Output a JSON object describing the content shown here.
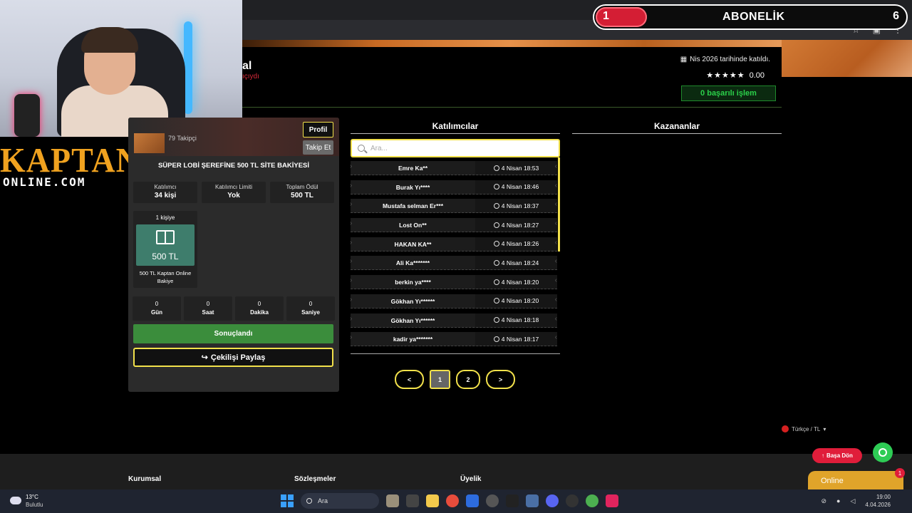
{
  "browser": {
    "window_controls": [
      "─",
      "▢",
      "✕"
    ],
    "toolbar_icons": [
      "☆",
      "▣",
      "⋮"
    ]
  },
  "subscriber_bar": {
    "left_count": "1",
    "title": "ABONELİK",
    "right_count": "6"
  },
  "logo": {
    "line1": "KAPTAN",
    "line2": "ONLINE.COM"
  },
  "profile": {
    "name": "al",
    "subtitle": "ıçıydı",
    "joined": "Nis 2026 tarihinde katıldı.",
    "stars": "★★★★★",
    "rating": "0.00",
    "success_label": "0 başarılı işlem"
  },
  "giveaway": {
    "followers": "79 Takipçi",
    "profile_btn": "Profil",
    "follow_btn": "Takip Et",
    "title": "SÜPER LOBİ ŞEREFİNE 500 TL SİTE BAKİYESİ",
    "stats": [
      {
        "label": "Katılımcı",
        "value": "34 kişi"
      },
      {
        "label": "Katılımcı Limiti",
        "value": "Yok"
      },
      {
        "label": "Toplam Ödül",
        "value": "500 TL"
      }
    ],
    "prize": {
      "count": "1 kişiye",
      "amount": "500 TL",
      "desc": "500 TL Kaptan Online Bakiye"
    },
    "timer": [
      {
        "value": "0",
        "label": "Gün"
      },
      {
        "value": "0",
        "label": "Saat"
      },
      {
        "value": "0",
        "label": "Dakika"
      },
      {
        "value": "0",
        "label": "Saniye"
      }
    ],
    "status_btn": "Sonuçlandı",
    "share_btn": "Çekilişi Paylaş"
  },
  "participants": {
    "title": "Katılımcılar",
    "search_placeholder": "Ara...",
    "rows": [
      {
        "name": "Emre Ka**",
        "date": "4 Nisan 18:53"
      },
      {
        "name": "Burak Yı****",
        "date": "4 Nisan 18:46"
      },
      {
        "name": "Mustafa selman Er***",
        "date": "4 Nisan 18:37"
      },
      {
        "name": "Lost On**",
        "date": "4 Nisan 18:27"
      },
      {
        "name": "HAKAN KA**",
        "date": "4 Nisan 18:26"
      },
      {
        "name": "Ali Ka*******",
        "date": "4 Nisan 18:24"
      },
      {
        "name": "berkin ya****",
        "date": "4 Nisan 18:20"
      },
      {
        "name": "Gökhan Yı******",
        "date": "4 Nisan 18:20"
      },
      {
        "name": "Gökhan Yı******",
        "date": "4 Nisan 18:18"
      },
      {
        "name": "kadir ya*******",
        "date": "4 Nisan 18:17"
      }
    ]
  },
  "winners": {
    "title": "Kazananlar"
  },
  "pagination": {
    "prev": "<",
    "pages": [
      "1",
      "2"
    ],
    "next": ">"
  },
  "language": "Türkçe / TL",
  "back_top": "Başa Dön",
  "online": {
    "label": "Online",
    "badge": "1"
  },
  "footer": {
    "col1": "Kurumsal",
    "col2": "Sözleşmeler",
    "col3": "Üyelik"
  },
  "taskbar": {
    "temp": "13°C",
    "weather": "Bulutlu",
    "search": "Ara",
    "time": "19:00",
    "date": "4.04.2026"
  },
  "colors": {
    "accent": "#f2e14b",
    "success": "#3b8d3c",
    "danger": "#e01d3a",
    "brand": "#f0a21f"
  }
}
